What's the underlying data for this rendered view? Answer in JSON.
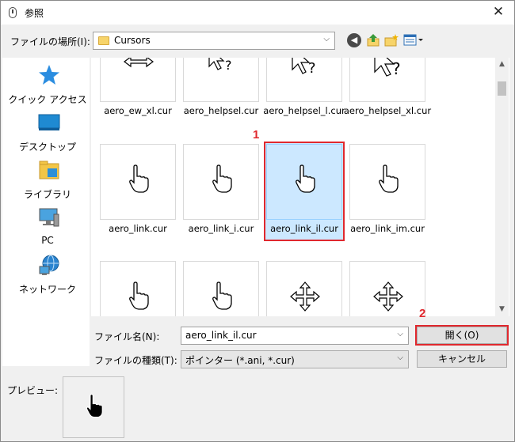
{
  "window": {
    "title": "参照",
    "close_glyph": "✕"
  },
  "location": {
    "label": "ファイルの場所(I):",
    "value": "Cursors"
  },
  "toolbar": {
    "back_glyph": "◀"
  },
  "sidebar": {
    "items": [
      {
        "label": "クイック アクセス",
        "icon": "star-icon"
      },
      {
        "label": "デスクトップ",
        "icon": "desktop-icon"
      },
      {
        "label": "ライブラリ",
        "icon": "library-icon"
      },
      {
        "label": "PC",
        "icon": "pc-icon"
      },
      {
        "label": "ネットワーク",
        "icon": "network-icon"
      }
    ]
  },
  "files": {
    "row1": [
      "aero_ew_xl.cur",
      "aero_helpsel.cur",
      "aero_helpsel_l.cur",
      "aero_helpsel_xl.cur"
    ],
    "row2": [
      "aero_link.cur",
      "aero_link_i.cur",
      "aero_link_il.cur",
      "aero_link_im.cur"
    ],
    "selected": "aero_link_il.cur"
  },
  "callouts": {
    "one": "1",
    "two": "2"
  },
  "filename": {
    "label": "ファイル名(N):",
    "value": "aero_link_il.cur"
  },
  "filetype": {
    "label": "ファイルの種類(T):",
    "value": "ポインター (*.ani, *.cur)"
  },
  "buttons": {
    "open": "開く(O)",
    "cancel": "キャンセル"
  },
  "preview": {
    "label": "プレビュー:"
  },
  "colors": {
    "accent_red": "#e0282e",
    "selection": "#cce8ff"
  }
}
